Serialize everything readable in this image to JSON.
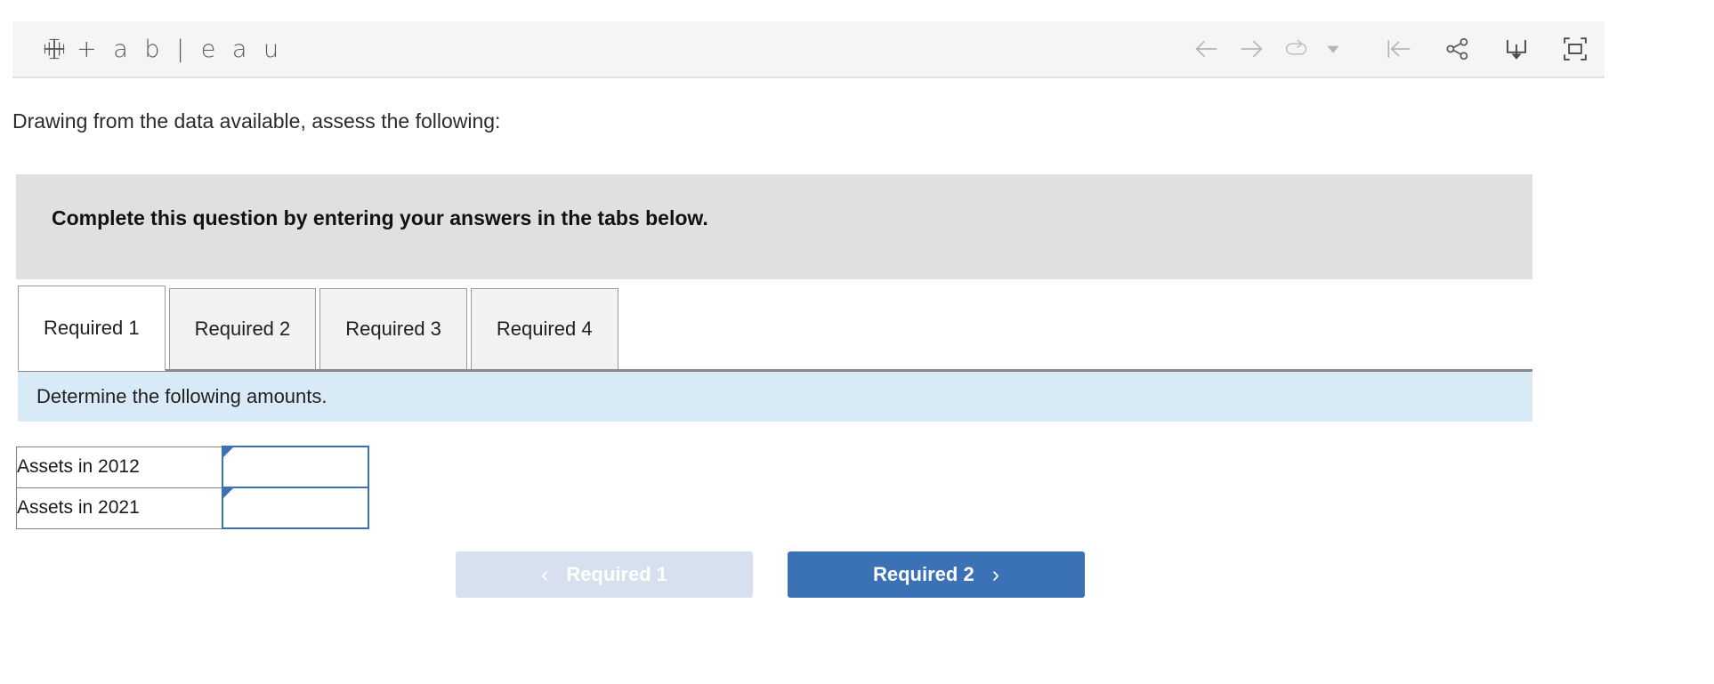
{
  "toolbar": {
    "logo_text": "+ a b | e a u",
    "logo_icon": "tableau-logo-icon",
    "actions": [
      {
        "name": "back-arrow-icon",
        "glyph": "←"
      },
      {
        "name": "forward-arrow-icon",
        "glyph": "→"
      },
      {
        "name": "redo-revert-icon",
        "glyph": "↻"
      },
      {
        "name": "dropdown-caret-icon",
        "glyph": "▼"
      },
      {
        "name": "revert-all-icon",
        "glyph": "|←"
      },
      {
        "name": "share-icon",
        "glyph": "share"
      },
      {
        "name": "download-icon",
        "glyph": "download"
      },
      {
        "name": "fullscreen-icon",
        "glyph": "fullscreen"
      }
    ]
  },
  "prompt": {
    "text": "Drawing from the data available, assess the following:"
  },
  "banner": {
    "text": "Complete this question by entering your answers in the tabs below."
  },
  "tabs": [
    {
      "label": "Required 1",
      "active": true
    },
    {
      "label": "Required 2",
      "active": false
    },
    {
      "label": "Required 3",
      "active": false
    },
    {
      "label": "Required 4",
      "active": false
    }
  ],
  "instruction": {
    "text": "Determine the following amounts."
  },
  "answer_table": {
    "rows": [
      {
        "label": "Assets in 2012",
        "value": "",
        "placeholder": ""
      },
      {
        "label": "Assets in 2021",
        "value": "",
        "placeholder": ""
      }
    ]
  },
  "nav": {
    "prev_label": "Required 1",
    "next_label": "Required 2",
    "prev_chevron": "‹",
    "next_chevron": "›"
  },
  "colors": {
    "accent_blue": "#3a72b5",
    "disabled_blue": "#d6e0ee",
    "instruction_blue": "#d9eaf7",
    "banner_gray": "#e0e0e0",
    "toolbar_gray": "#f5f5f5"
  }
}
